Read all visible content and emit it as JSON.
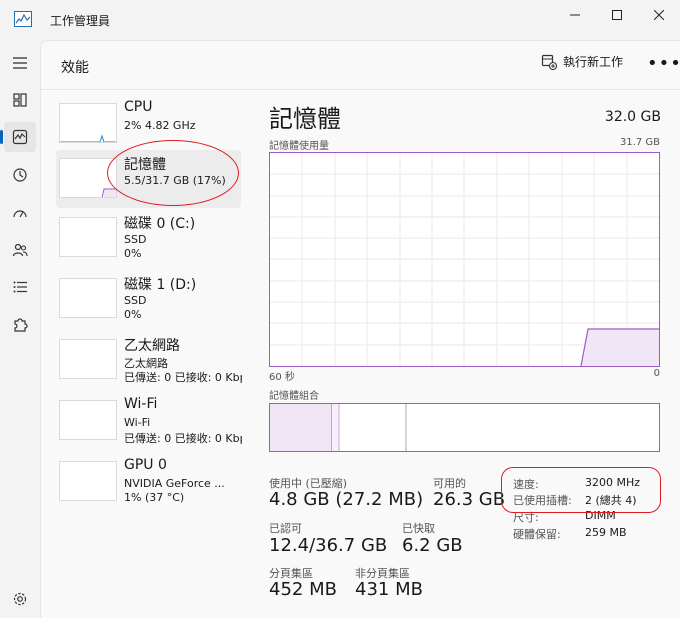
{
  "app": {
    "title": "工作管理員"
  },
  "header": {
    "title": "效能",
    "run_task_label": "執行新工作",
    "more_label": "•••"
  },
  "sidebar": [
    {
      "name": "CPU",
      "line1": "2% 4.82 GHz",
      "line2": ""
    },
    {
      "name": "記憶體",
      "line1": "5.5/31.7 GB (17%)",
      "line2": ""
    },
    {
      "name": "磁碟 0 (C:)",
      "line1": "SSD",
      "line2": "0%"
    },
    {
      "name": "磁碟 1 (D:)",
      "line1": "SSD",
      "line2": "0%"
    },
    {
      "name": "乙太網路",
      "line1": "乙太網路",
      "line2": "已傳送: 0 已接收: 0 Kbps"
    },
    {
      "name": "Wi-Fi",
      "line1": "Wi-Fi",
      "line2": "已傳送: 0 已接收: 0 Kbps"
    },
    {
      "name": "GPU 0",
      "line1": "NVIDIA GeForce ...",
      "line2": "1% (37 °C)"
    }
  ],
  "main": {
    "title": "記憶體",
    "total": "32.0 GB",
    "usage_label": "記憶體使用量",
    "usage_max": "31.7 GB",
    "axis_left": "60 秒",
    "axis_right": "0",
    "composition_label": "記憶體組合"
  },
  "stats": {
    "in_use_label": "使用中 (已壓縮)",
    "in_use_value": "4.8 GB (27.2 MB)",
    "available_label": "可用的",
    "available_value": "26.3 GB",
    "committed_label": "已認可",
    "committed_value": "12.4/36.7 GB",
    "cached_label": "已快取",
    "cached_value": "6.2 GB",
    "paged_label": "分頁集區",
    "paged_value": "452 MB",
    "nonpaged_label": "非分頁集區",
    "nonpaged_value": "431 MB"
  },
  "props": {
    "speed_label": "速度:",
    "speed_value": "3200 MHz",
    "slots_label": "已使用插槽:",
    "slots_value": "2 (總共 4)",
    "form_label": "尺寸:",
    "form_value": "DIMM",
    "reserved_label": "硬體保留:",
    "reserved_value": "259 MB"
  },
  "colors": {
    "memory": "#9d5bc4",
    "cpu": "#1a8fd6",
    "highlight": "#e01b24",
    "accent": "#0067c0"
  }
}
